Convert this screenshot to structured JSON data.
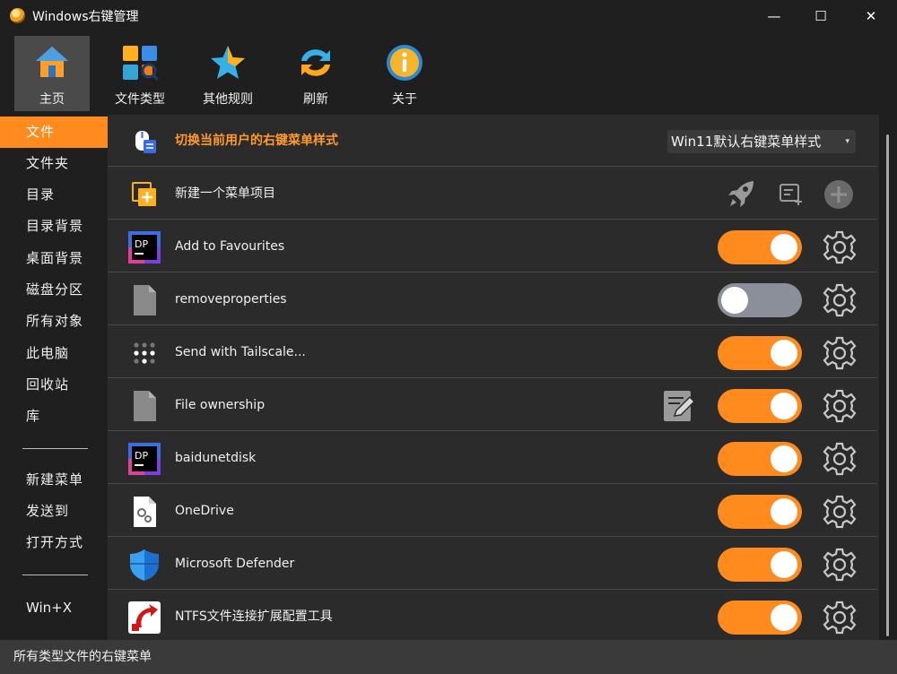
{
  "window": {
    "title": "Windows右键管理",
    "minimize_glyph": "—",
    "maximize_glyph": "☐",
    "close_glyph": "✕"
  },
  "toolbar": {
    "items": [
      {
        "label": "主页",
        "icon": "home-icon",
        "active": true
      },
      {
        "label": "文件类型",
        "icon": "file-types-icon",
        "active": false
      },
      {
        "label": "其他规则",
        "icon": "star-icon",
        "active": false
      },
      {
        "label": "刷新",
        "icon": "refresh-icon",
        "active": false
      },
      {
        "label": "关于",
        "icon": "info-icon",
        "active": false
      }
    ]
  },
  "sidebar": {
    "items": [
      {
        "label": "文件",
        "active": true
      },
      {
        "label": "文件夹"
      },
      {
        "label": "目录"
      },
      {
        "label": "目录背景"
      },
      {
        "label": "桌面背景"
      },
      {
        "label": "磁盘分区"
      },
      {
        "label": "所有对象"
      },
      {
        "label": "此电脑"
      },
      {
        "label": "回收站"
      },
      {
        "label": "库"
      }
    ],
    "group2": [
      {
        "label": "新建菜单"
      },
      {
        "label": "发送到"
      },
      {
        "label": "打开方式"
      }
    ],
    "group3": [
      {
        "label": "Win+X"
      }
    ]
  },
  "main": {
    "style_row": {
      "label": "切换当前用户的右键菜单样式",
      "icon": "context-menu-style-icon",
      "dropdown_value": "Win11默认右键菜单样式",
      "caret": "▾"
    },
    "new_row": {
      "label": "新建一个菜单项目",
      "icon": "new-item-icon",
      "actions": [
        "rocket-icon",
        "edit-add-icon",
        "plus-circle-icon"
      ]
    },
    "entries": [
      {
        "label": "Add to Favourites",
        "icon": "dp-app-icon",
        "enabled": true
      },
      {
        "label": "removeproperties",
        "icon": "file-icon",
        "enabled": false
      },
      {
        "label": "Send with Tailscale...",
        "icon": "tailscale-dots-icon",
        "enabled": true
      },
      {
        "label": "File ownership",
        "icon": "file-icon",
        "enabled": true,
        "extra_icon": "edit-note-icon"
      },
      {
        "label": "baidunetdisk",
        "icon": "dp-app-icon",
        "enabled": true
      },
      {
        "label": "OneDrive",
        "icon": "file-settings-icon",
        "enabled": true
      },
      {
        "label": "Microsoft Defender",
        "icon": "shield-icon",
        "enabled": true
      },
      {
        "label": "NTFS文件连接扩展配置工具",
        "icon": "ntfs-link-icon",
        "enabled": true
      }
    ]
  },
  "status": {
    "text": "所有类型文件的右键菜单"
  },
  "colors": {
    "accent": "#ff8a1e",
    "background": "#1f1f1f",
    "panel": "#2b2b2b",
    "toggle_off": "#8a8f99"
  }
}
